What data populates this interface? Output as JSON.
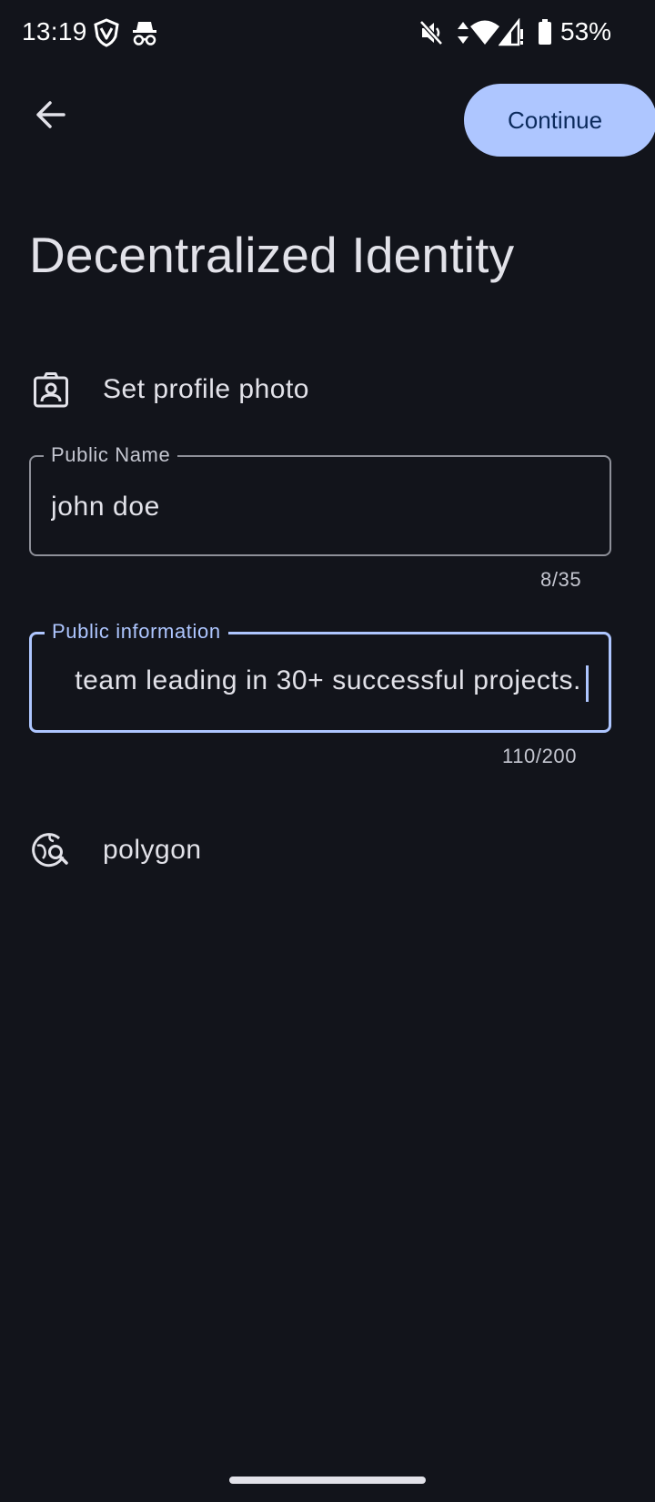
{
  "status_bar": {
    "time": "13:19",
    "battery": "53%",
    "icons": [
      "vpn-shield-icon",
      "incognito-icon",
      "mute-icon",
      "data-arrows-icon",
      "wifi-icon",
      "signal-icon",
      "battery-icon"
    ]
  },
  "app_bar": {
    "back_icon": "arrow-back-icon",
    "continue_label": "Continue"
  },
  "page": {
    "title": "Decentralized Identity"
  },
  "profile_photo": {
    "icon": "account-box-icon",
    "label": "Set profile photo"
  },
  "public_name": {
    "label": "Public Name",
    "value": "john doe",
    "counter": "8/35"
  },
  "public_information": {
    "label": "Public information",
    "visible_value": "team leading in 30+ successful projects.",
    "counter": "110/200"
  },
  "network": {
    "icon": "travel-explore-icon",
    "label": "polygon"
  },
  "colors": {
    "background": "#12141b",
    "accent": "#aec6ff",
    "on_accent": "#0b2a5c",
    "text": "#e2e2e9",
    "outline": "#8e9099"
  }
}
